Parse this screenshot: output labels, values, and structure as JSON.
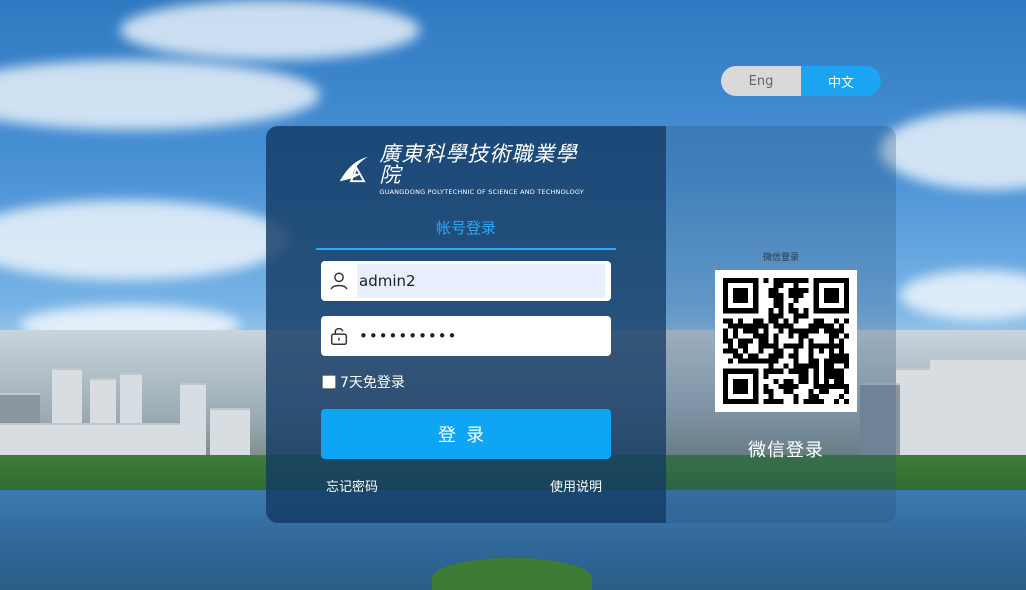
{
  "language_switch": {
    "eng_label": "Eng",
    "zh_label": "中文",
    "active": "中文"
  },
  "logo": {
    "name_cn": "廣東科學技術職業學院",
    "name_en": "GUANGDONG POLYTECHNIC OF SCIENCE AND TECHNOLOGY"
  },
  "login": {
    "tab_label": "帐号登录",
    "username_value": "admin2",
    "password_value": "••••••••••",
    "remember_label": "7天免登录",
    "submit_label": "登录",
    "forgot_label": "忘记密码",
    "help_label": "使用说明"
  },
  "wechat": {
    "small_caption": "微信登录",
    "caption": "微信登录"
  },
  "icons": {
    "user": "user-icon",
    "lock": "lock-icon",
    "logo": "school-logo-icon",
    "qr": "qr-code-icon"
  },
  "colors": {
    "accent": "#0ea5f5",
    "tab_accent": "#2aa8f5",
    "panel": "#143a64",
    "lang_inactive": "#d9d9d9"
  }
}
